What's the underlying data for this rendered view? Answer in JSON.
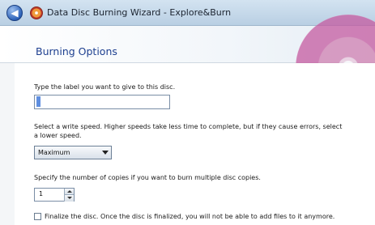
{
  "window": {
    "title": "Data Disc Burning Wizard - Explore&Burn",
    "back_icon": "back-arrow-icon",
    "app_icon": "disc-app-icon"
  },
  "header": {
    "title": "Burning Options",
    "accent_color": "#1d3f8f"
  },
  "form": {
    "label_prompt": "Type the label you want to give to this disc.",
    "label_value": "",
    "speed_prompt_line1": "Select a write speed. Higher speeds take less time to complete, but if they cause errors, select",
    "speed_prompt_line2": "a lower speed.",
    "speed_selected": "Maximum",
    "copies_prompt": "Specify the number of copies if you want to burn multiple disc copies.",
    "copies_value": "1",
    "finalize_label": "Finalize the disc. Once the disc is finalized, you will not be able to add files to it anymore.",
    "finalize_checked": false
  }
}
